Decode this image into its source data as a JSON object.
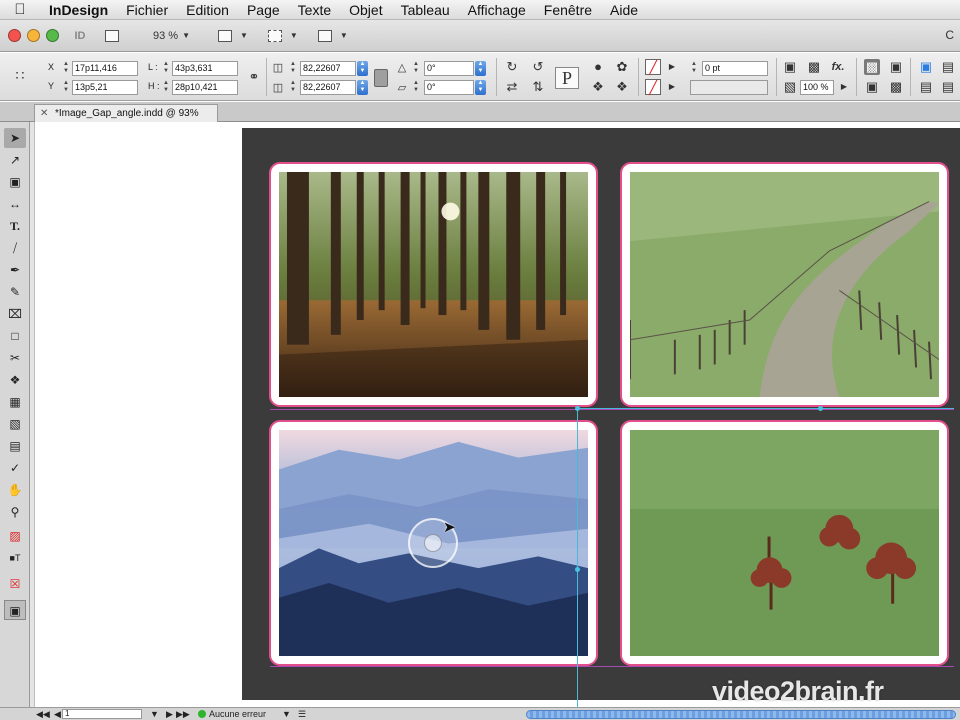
{
  "menubar": {
    "app": "InDesign",
    "items": [
      "Fichier",
      "Edition",
      "Page",
      "Texte",
      "Objet",
      "Tableau",
      "Affichage",
      "Fenêtre",
      "Aide"
    ]
  },
  "appbar": {
    "zoom": "93 %",
    "right_text": "C"
  },
  "control": {
    "x_label": "X",
    "x_value": "17p11,416",
    "y_label": "Y",
    "y_value": "13p5,21",
    "w_label": "L :",
    "w_value": "43p3,631",
    "h_label": "H :",
    "h_value": "28p10,421",
    "scale_x": "82,22607",
    "scale_y": "82,22607",
    "rotate": "0°",
    "shear": "0°",
    "stroke_weight": "0 pt",
    "opacity": "100 %"
  },
  "document_tab": {
    "title": "*Image_Gap_angle.indd @ 93%"
  },
  "images": [
    {
      "name": "forest",
      "alt": "sunlit forest"
    },
    {
      "name": "path",
      "alt": "country path with fence"
    },
    {
      "name": "misty-hills",
      "alt": "misty blue hills"
    },
    {
      "name": "meadow-trees",
      "alt": "meadow with red trees"
    }
  ],
  "statusbar": {
    "page": "1",
    "preflight": "Aucune erreur"
  },
  "watermark": "video2brain.fr",
  "colors": {
    "frame_stroke": "#e24d8c",
    "pasteboard": "#3b3b3b",
    "selection": "#49b9d8",
    "guides": "#a54bb0"
  }
}
